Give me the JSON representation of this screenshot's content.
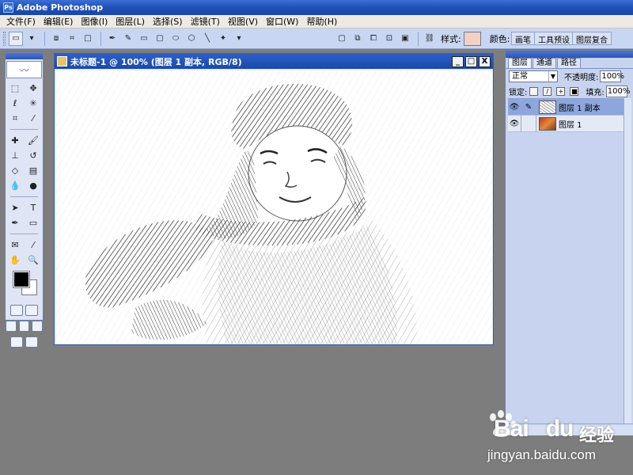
{
  "app": {
    "title": "Adobe Photoshop"
  },
  "menu": [
    "文件(F)",
    "编辑(E)",
    "图像(I)",
    "图层(L)",
    "选择(S)",
    "滤镜(T)",
    "视图(V)",
    "窗口(W)",
    "帮助(H)"
  ],
  "options": {
    "style_label": "样式:",
    "color_label": "颜色:",
    "style_swatch_color": "#f3cfc4",
    "color_swatch_color": "#000000",
    "palette_well": [
      "画笔",
      "工具预设",
      "图层复合"
    ]
  },
  "document": {
    "title": "未标题-1 @ 100% (图层 1 副本, RGB/8)",
    "controls": [
      "_",
      "□",
      "X"
    ]
  },
  "colors": {
    "foreground": "#000000",
    "background": "#ffffff"
  },
  "layers_panel": {
    "tabs": [
      "图层",
      "通道",
      "路径"
    ],
    "blend_mode": "正常",
    "opacity_label": "不透明度:",
    "opacity_value": "100%",
    "lock_label": "锁定:",
    "fill_label": "填充:",
    "fill_value": "100%",
    "layers": [
      {
        "name": "图层 1 副本",
        "selected": true
      },
      {
        "name": "图层 1",
        "selected": false
      }
    ]
  },
  "watermark": {
    "brand": "Bai",
    "brand_du": "du",
    "cn": "经验",
    "url": "jingyan.baidu.com"
  }
}
